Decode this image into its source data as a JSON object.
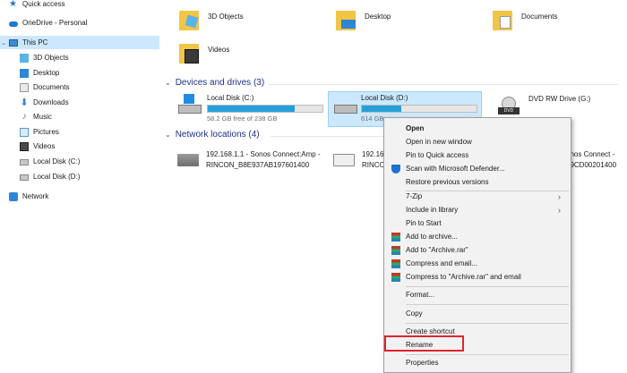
{
  "sidebar": {
    "quick_access": "Quick access",
    "onedrive": "OneDrive - Personal",
    "this_pc": "This PC",
    "items": [
      "3D Objects",
      "Desktop",
      "Documents",
      "Downloads",
      "Music",
      "Pictures",
      "Videos",
      "Local Disk (C:)",
      "Local Disk (D:)"
    ],
    "network": "Network"
  },
  "folders": [
    "3D Objects",
    "Desktop",
    "Documents",
    "Videos"
  ],
  "devices": {
    "heading": "Devices and drives (3)",
    "drives": [
      {
        "name": "Local Disk (C:)",
        "free": "58.2 GB free of 238 GB",
        "used_pct": 76
      },
      {
        "name": "Local Disk (D:)",
        "free": "614 GB",
        "used_pct": 34
      },
      {
        "name": "DVD RW Drive (G:)"
      }
    ]
  },
  "network": {
    "heading": "Network locations (4)",
    "items": [
      {
        "line1": "192.168.1.1 - Sonos Connect:Amp -",
        "line2": "RINCON_B8E937AB197601400"
      },
      {
        "line1": "192.168.1",
        "line2": "RINCON_"
      },
      {
        "line1": "onos Connect -",
        "line2": "79CD00201400"
      }
    ]
  },
  "context_menu": {
    "open": "Open",
    "open_new_window": "Open in new window",
    "pin_quick_access": "Pin to Quick access",
    "scan_defender": "Scan with Microsoft Defender...",
    "restore_versions": "Restore previous versions",
    "seven_zip": "7-Zip",
    "include_library": "Include in library",
    "pin_start": "Pin to Start",
    "add_archive": "Add to archive...",
    "add_archive_rar": "Add to \"Archive.rar\"",
    "compress_email": "Compress and email...",
    "compress_rar_email": "Compress to \"Archive.rar\" and email",
    "format": "Format...",
    "copy": "Copy",
    "create_shortcut": "Create shortcut",
    "rename": "Rename",
    "properties": "Properties",
    "submenu_arrow": "›"
  },
  "colors": {
    "accent_blue": "#26a0da",
    "section_heading": "#1e3287",
    "selection": "#cce8ff",
    "highlight_red": "#e0242d"
  }
}
